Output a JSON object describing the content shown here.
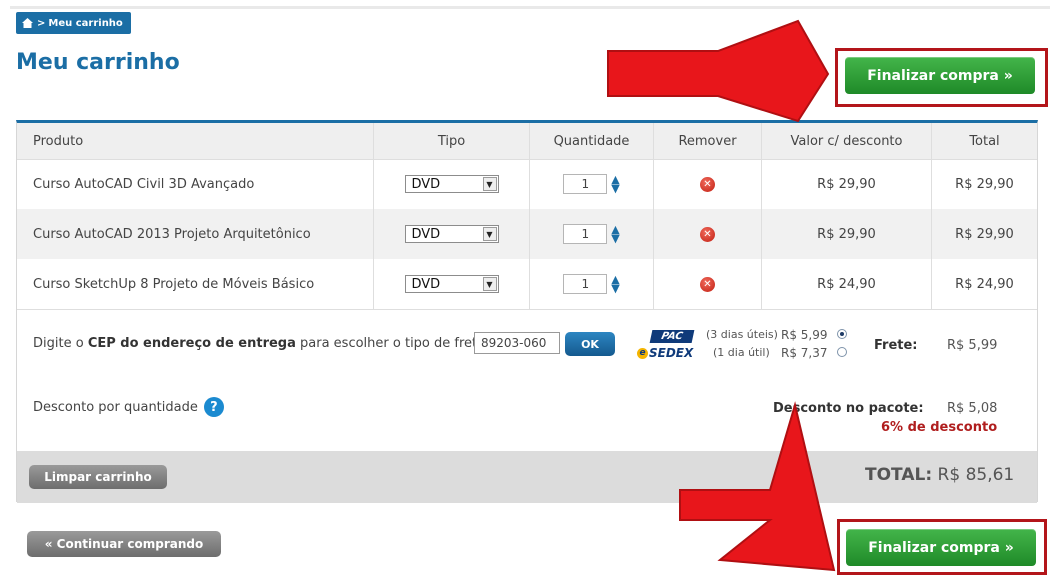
{
  "breadcrumb": {
    "home_icon": "home-icon",
    "separator": ">",
    "label": "Meu carrinho"
  },
  "page_title": "Meu carrinho",
  "checkout_button": "Finalizar compra »",
  "table": {
    "headers": [
      "Produto",
      "Tipo",
      "Quantidade",
      "Remover",
      "Valor c/ desconto",
      "Total"
    ],
    "rows": [
      {
        "produto": "Curso AutoCAD Civil 3D Avançado",
        "tipo": "DVD",
        "quantidade": "1",
        "valor": "R$ 29,90",
        "total": "R$ 29,90"
      },
      {
        "produto": "Curso AutoCAD 2013 Projeto Arquitetônico",
        "tipo": "DVD",
        "quantidade": "1",
        "valor": "R$ 29,90",
        "total": "R$ 29,90"
      },
      {
        "produto": "Curso SketchUp 8 Projeto de Móveis Básico",
        "tipo": "DVD",
        "quantidade": "1",
        "valor": "R$ 24,90",
        "total": "R$ 24,90"
      }
    ]
  },
  "shipping": {
    "prefix": "Digite o ",
    "bold": "CEP do endereço de entrega",
    "suffix": " para escolher o tipo de frete:",
    "cep_value": "89203-060",
    "ok_button": "OK",
    "options": [
      {
        "logo": "PAC",
        "time": "(3 dias úteis)",
        "price": "R$ 5,99",
        "selected": true
      },
      {
        "logo": "SEDEX",
        "time": "(1 dia útil)",
        "price": "R$ 7,37",
        "selected": false
      }
    ],
    "frete_label": "Frete:",
    "frete_value": "R$ 5,99"
  },
  "discount": {
    "label": "Desconto por quantidade",
    "package_label": "Desconto no pacote:",
    "package_value": "R$ 5,08",
    "percent_text": "6% de desconto"
  },
  "footer": {
    "clear_button": "Limpar carrinho",
    "total_label": "TOTAL:",
    "total_value": "R$ 85,61"
  },
  "continue_button": "« Continuar comprando",
  "colors": {
    "brand_blue": "#1b6ea5",
    "green_button": "#2a9a32",
    "highlight_red": "#b3151a",
    "arrow_red": "#e8161b"
  }
}
